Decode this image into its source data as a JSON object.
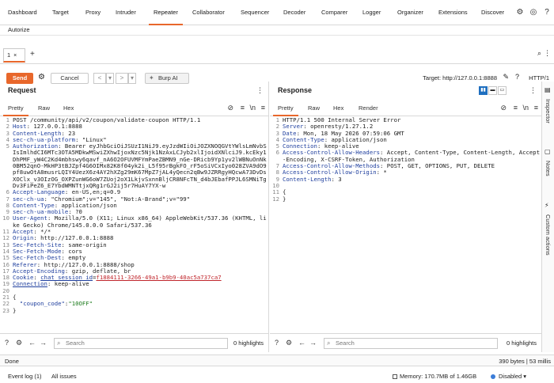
{
  "nav": {
    "tabs": [
      "Dashboard",
      "Target",
      "Proxy",
      "Intruder",
      "Repeater",
      "Collaborator",
      "Sequencer",
      "Decoder",
      "Comparer",
      "Logger",
      "Organizer",
      "Extensions",
      "Discover"
    ],
    "active_index": 4,
    "subtab": "Autorize"
  },
  "repeater_tab": {
    "label": "1",
    "close": "×",
    "add": "+"
  },
  "toolbar": {
    "send": "Send",
    "cancel": "Cancel",
    "prev": "<",
    "prev_menu": "▾",
    "next": ">",
    "next_menu": "▾",
    "burp_ai": "Burp AI",
    "target": "Target: http://127.0.0.1:8888",
    "http_version": "HTTP/1"
  },
  "request": {
    "title": "Request",
    "tabs": [
      "Pretty",
      "Raw",
      "Hex"
    ],
    "lines": [
      "POST /community/api/v2/coupon/validate-coupon HTTP/1.1",
      "Host: 127.0.0.1:8888",
      "Content-Length: 23",
      "sec-ch-ua-platform: \"Linux\"",
      "Authorization: Bearer eyJhbGciOiJSUzI1NiJ9.eyJzdWIiOiJOZXNOQGVtYWlsLmNvbSIsImlhdCI6MTc3OTA5MDkwMSwiZXhwIjoxNzc5Njk1NzAxLCJyb2xlIjoidXNlciJ9.kcEky1DhPMF_yW4C2Kd4mbhswy6qavf_nA6O2OFUVMFYmPaeZBMN9_nGe-DRicb9Yp1yv2lWBNuOnNk0BM52qnO-MkHP3tBJZpf4G6OIMx82K8f04yk2i_L5f95rBgkFO_rF5oSiVCxIyo028ZVA9dO9pf8uwOtA8musrLQIY4UezX6z4AY2hXZg29mK67MpZ7jAL4yQecn2qBw9JZRRgyHQcwA73DvDsXOClx_v3OIzOG_OXPZunWG6oW7ZUoj2oX1LkjvSxnnBljCR8NFcTN_d4bJEbafPPJL6SMNiTgDv3FiPeZ6_E7YbdWMNTtjxQRg1rGJ2ij5r7HuAY7YX-w",
      "Accept-Language: en-US,en;q=0.9",
      "sec-ch-ua: \"Chromium\";v=\"145\", \"Not:A-Brand\";v=\"99\"",
      "Content-Type: application/json",
      "sec-ch-ua-mobile: ?0",
      "User-Agent: Mozilla/5.0 (X11; Linux x86_64) AppleWebKit/537.36 (KHTML, like Gecko) Chrome/145.0.0.0 Safari/537.36",
      "Accept: */*",
      "Origin: http://127.0.0.1:8888",
      "Sec-Fetch-Site: same-origin",
      "Sec-Fetch-Mode: cors",
      "Sec-Fetch-Dest: empty",
      "Referer: http://127.0.0.1:8888/shop",
      "Accept-Encoding: gzip, deflate, br",
      "Cookie: chat_session_id=f1884111-3266-49a1-b9b9-40ac5a737ca7",
      "Connection: keep-alive",
      "",
      "{",
      "  \"coupon_code\":\"10OFF\"",
      "}"
    ],
    "search_placeholder": "Search",
    "highlights": "0 highlights"
  },
  "response": {
    "title": "Response",
    "tabs": [
      "Pretty",
      "Raw",
      "Hex",
      "Render"
    ],
    "lines": [
      "HTTP/1.1 500 Internal Server Error",
      "Server: openresty/1.27.1.2",
      "Date: Mon, 18 May 2026 07:59:06 GMT",
      "Content-Type: application/json",
      "Connection: keep-alive",
      "Access-Control-Allow-Headers: Accept, Content-Type, Content-Length, Accept-Encoding, X-CSRF-Token, Authorization",
      "Access-Control-Allow-Methods: POST, GET, OPTIONS, PUT, DELETE",
      "Access-Control-Allow-Origin: *",
      "Content-Length: 3",
      "",
      "{",
      "}"
    ],
    "search_placeholder": "Search",
    "highlights": "0 highlights"
  },
  "sidebar": {
    "items": [
      "Inspector",
      "Notes",
      "Custom actions"
    ]
  },
  "status": {
    "left": "Done",
    "right": "390 bytes | 53 millis"
  },
  "bottom": {
    "event_log": "Event log (1)",
    "all_issues": "All issues",
    "memory": "Memory: 170.7MB of 1.46GB",
    "disabled": "Disabled"
  },
  "colors": {
    "accent": "#e8672b",
    "header_key": "#1f3f9e",
    "json_string": "#1a7a1a",
    "cookie_value": "#c0262c"
  }
}
